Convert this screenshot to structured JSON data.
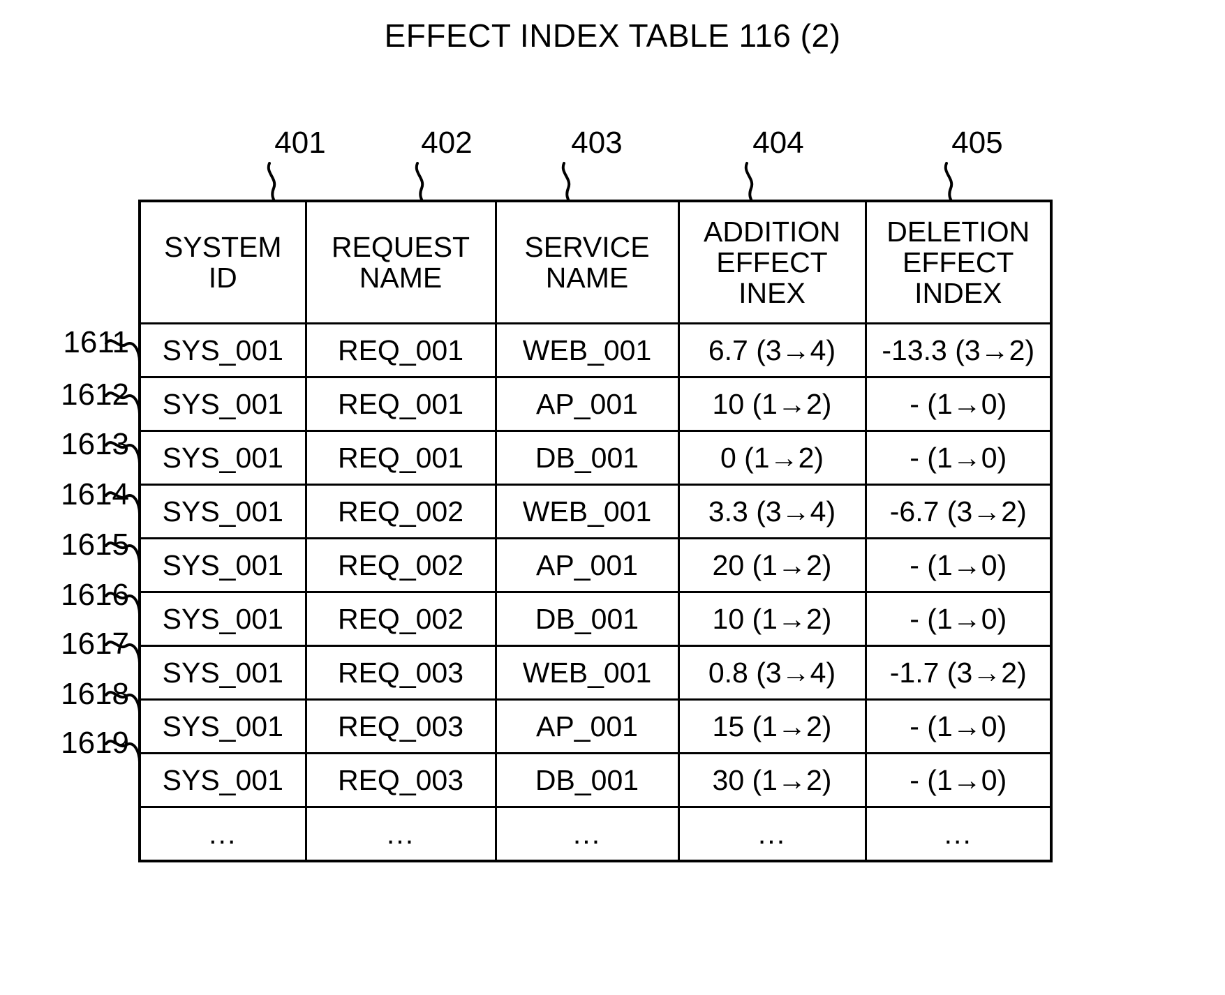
{
  "figure": {
    "title": "EFFECT INDEX TABLE 116 (2)"
  },
  "column_refs": [
    {
      "id": "401",
      "label": "401"
    },
    {
      "id": "402",
      "label": "402"
    },
    {
      "id": "403",
      "label": "403"
    },
    {
      "id": "404",
      "label": "404"
    },
    {
      "id": "405",
      "label": "405"
    }
  ],
  "row_refs": [
    {
      "label": "1611"
    },
    {
      "label": "1612"
    },
    {
      "label": "1613"
    },
    {
      "label": "1614"
    },
    {
      "label": "1615"
    },
    {
      "label": "1616"
    },
    {
      "label": "1617"
    },
    {
      "label": "1618"
    },
    {
      "label": "1619"
    }
  ],
  "table": {
    "headers": [
      {
        "lines": [
          "SYSTEM",
          "ID"
        ]
      },
      {
        "lines": [
          "REQUEST",
          "NAME"
        ]
      },
      {
        "lines": [
          "SERVICE",
          "NAME"
        ]
      },
      {
        "lines": [
          "ADDITION",
          "EFFECT",
          "INEX"
        ]
      },
      {
        "lines": [
          "DELETION",
          "EFFECT",
          "INDEX"
        ]
      }
    ],
    "rows": [
      {
        "system_id": "SYS_001",
        "request_name": "REQ_001",
        "service_name": "WEB_001",
        "addition_effect_index": "6.7 (3→4)",
        "deletion_effect_index": "-13.3 (3→2)"
      },
      {
        "system_id": "SYS_001",
        "request_name": "REQ_001",
        "service_name": "AP_001",
        "addition_effect_index": "10 (1→2)",
        "deletion_effect_index": "- (1→0)"
      },
      {
        "system_id": "SYS_001",
        "request_name": "REQ_001",
        "service_name": "DB_001",
        "addition_effect_index": "0 (1→2)",
        "deletion_effect_index": "- (1→0)"
      },
      {
        "system_id": "SYS_001",
        "request_name": "REQ_002",
        "service_name": "WEB_001",
        "addition_effect_index": "3.3 (3→4)",
        "deletion_effect_index": "-6.7 (3→2)"
      },
      {
        "system_id": "SYS_001",
        "request_name": "REQ_002",
        "service_name": "AP_001",
        "addition_effect_index": "20 (1→2)",
        "deletion_effect_index": "- (1→0)"
      },
      {
        "system_id": "SYS_001",
        "request_name": "REQ_002",
        "service_name": "DB_001",
        "addition_effect_index": "10 (1→2)",
        "deletion_effect_index": "- (1→0)"
      },
      {
        "system_id": "SYS_001",
        "request_name": "REQ_003",
        "service_name": "WEB_001",
        "addition_effect_index": "0.8 (3→4)",
        "deletion_effect_index": "-1.7 (3→2)"
      },
      {
        "system_id": "SYS_001",
        "request_name": "REQ_003",
        "service_name": "AP_001",
        "addition_effect_index": "15 (1→2)",
        "deletion_effect_index": "- (1→0)"
      },
      {
        "system_id": "SYS_001",
        "request_name": "REQ_003",
        "service_name": "DB_001",
        "addition_effect_index": "30 (1→2)",
        "deletion_effect_index": "- (1→0)"
      }
    ],
    "continuation_row": {
      "system_id": "...",
      "request_name": "...",
      "service_name": "...",
      "addition_effect_index": "...",
      "deletion_effect_index": "..."
    }
  }
}
